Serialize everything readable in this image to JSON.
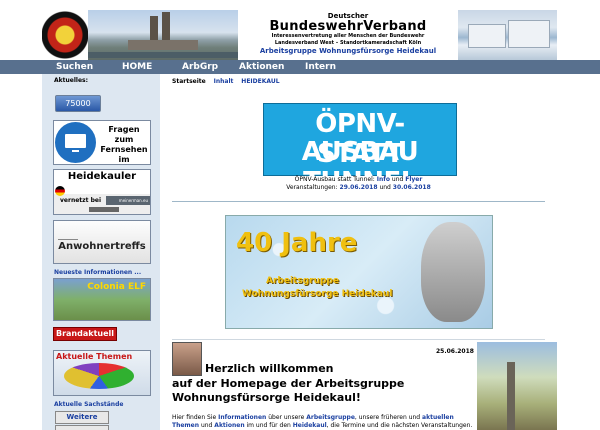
{
  "header": {
    "line1": "Deutscher",
    "line2": "BundeswehrVerband",
    "line3": "Interessenvertretung aller Menschen der Bundeswehr",
    "line4": "Landesverband West – Standortkameradschaft Köln",
    "line5": "Arbeitsgruppe Wohnungsfürsorge Heidekaul"
  },
  "nav": [
    "Suchen",
    "HOME",
    "ArbGrp",
    "Aktionen",
    "Intern"
  ],
  "sidebar": {
    "aktuelles_label": "Aktuelles:",
    "counter": "75000",
    "tv_text": "Fragen zum Fernsehen im Heidekaul",
    "heidekauler_title": "Heidekauler",
    "heidekauler_sub": "vernetzt bei",
    "heidekauler_badge": "meinerman.eu",
    "anwohner": "Anwohnertreffs",
    "neueste_label": "Neueste Informationen ...",
    "colonia": "Colonia ELF",
    "brand": "Brandaktuell",
    "themen": "Aktuelle Themen",
    "sachstaende_label": "Aktuelle Sachstände",
    "news_btn": "Weitere News"
  },
  "breadcrumb": [
    "Startseite",
    "Inhalt",
    "HEIDEKAUL"
  ],
  "opnv": {
    "line1": "ÖPNV-AUSBAU",
    "line2": "STATT TUNNEL",
    "info_prefix": "ÖPNV-Ausbau statt Tunnel:",
    "info_link1": "Info",
    "info_und": "und",
    "info_link2": "Flyer",
    "veranst_prefix": "Veranstaltungen:",
    "veranst_date1": "29.06.2018",
    "veranst_date2": "30.06.2018"
  },
  "jahre": {
    "title": "40 Jahre",
    "line2": "Arbeitsgruppe",
    "line3": "Wohnungsfürsorge Heidekaul"
  },
  "welcome": {
    "date": "25.06.2018",
    "title": "Herzlich willkommen",
    "sub1": "auf der Homepage der Arbeitsgruppe",
    "sub2": "Wohnungsfürsorge Heidekaul!",
    "p1_a": "Hier finden Sie",
    "p1_b": "Informationen",
    "p1_c": "über unsere",
    "p1_d": "Arbeitsgruppe",
    "p1_e": ", unsere früheren und",
    "p1_f": "aktuellen",
    "p2_a": "Themen",
    "p2_b": "und",
    "p2_c": "Aktionen",
    "p2_d": "im und für den",
    "p2_e": "Heidekaul",
    "p2_f": ", die Termine und die nächsten Veranstaltungen."
  },
  "colors": {
    "nav": "#58708e",
    "sidebar": "#dde7f1",
    "link": "#1a3fa0",
    "opnv": "#1fa6df",
    "brand": "#c81818",
    "jahre_text": "#f0c010"
  }
}
